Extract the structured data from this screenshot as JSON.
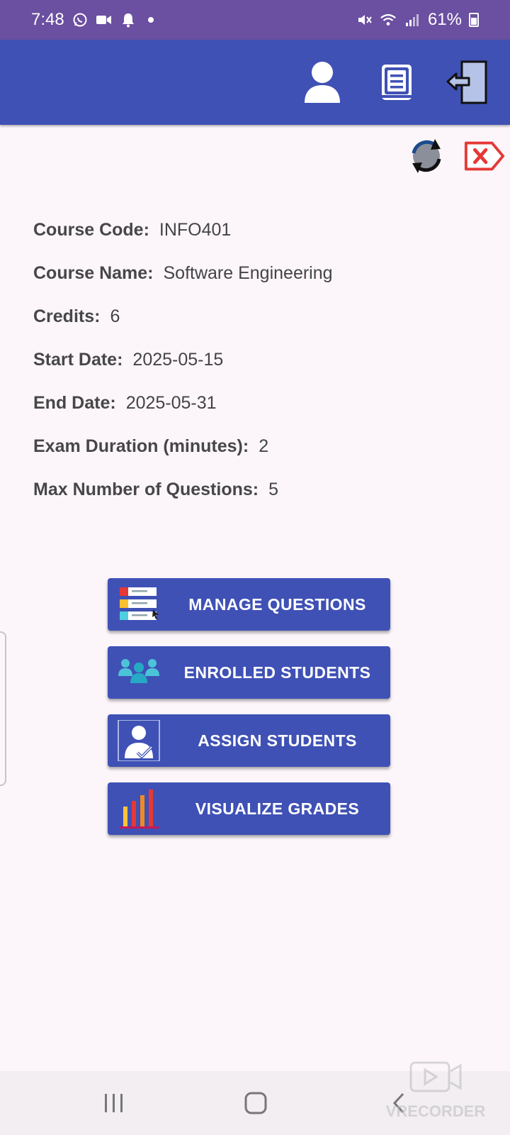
{
  "status_bar": {
    "time": "7:48",
    "battery": "61%"
  },
  "app_bar": {
    "icons": [
      "person-icon",
      "book-icon",
      "logout-icon"
    ]
  },
  "top_actions": {
    "icons": [
      "refresh-icon",
      "close-tag-icon"
    ]
  },
  "course": {
    "code_label": "Course Code:",
    "code": "INFO401",
    "name_label": "Course Name:",
    "name": "Software Engineering",
    "credits_label": "Credits:",
    "credits": "6",
    "start_label": "Start Date:",
    "start": "2025-05-15",
    "end_label": "End Date:",
    "end": "2025-05-31",
    "duration_label": "Exam Duration (minutes):",
    "duration": "2",
    "max_q_label": "Max Number of Questions:",
    "max_q": "5"
  },
  "buttons": {
    "manage_questions": "MANAGE QUESTIONS",
    "enrolled_students": "ENROLLED STUDENTS",
    "assign_students": "ASSIGN STUDENTS",
    "visualize_grades": "VISUALIZE GRADES"
  },
  "watermark": {
    "text": "VRECORDER"
  },
  "colors": {
    "status_bar": "#6b4fa0",
    "app_bar": "#3f51b5",
    "background": "#fcf6fb",
    "close_red": "#e53935"
  }
}
